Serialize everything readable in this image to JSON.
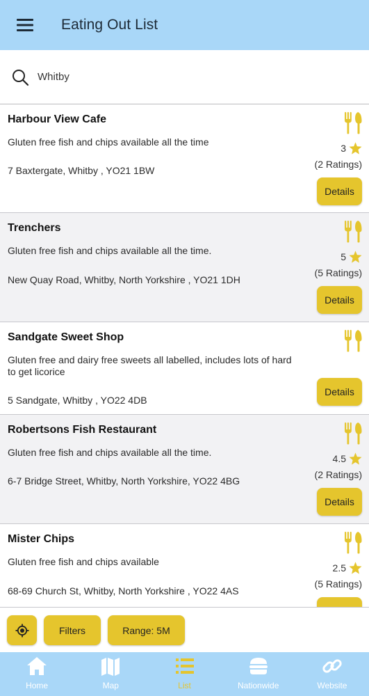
{
  "app": {
    "title": "Eating Out List"
  },
  "search": {
    "value": "Whitby"
  },
  "colors": {
    "header": "#a9d7f8",
    "accent": "#e5c52d",
    "tab_active": "#e5c52d"
  },
  "icons": {
    "menu": "hamburger-menu-icon",
    "search": "magnifier-icon",
    "cutlery": "fork-knife-icon",
    "star": "star-icon",
    "locate": "crosshair-icon"
  },
  "listings": [
    {
      "name": "Harbour View Cafe",
      "description": "Gluten free fish and chips available all the time",
      "address": "7 Baxtergate, Whitby , YO21 1BW",
      "rating": "3",
      "ratings_count": "(2 Ratings)",
      "details_label": "Details"
    },
    {
      "name": "Trenchers",
      "description": "Gluten free fish and chips available all the time.",
      "address": "New Quay Road, Whitby, North Yorkshire , YO21 1DH",
      "rating": "5",
      "ratings_count": "(5 Ratings)",
      "details_label": "Details"
    },
    {
      "name": "Sandgate Sweet Shop",
      "description": "Gluten free and dairy free sweets all labelled, includes lots of hard to get licorice",
      "address": "5 Sandgate, Whitby , YO22 4DB",
      "details_label": "Details"
    },
    {
      "name": "Robertsons Fish Restaurant",
      "description": "Gluten free fish and chips available all the time.",
      "address": "6-7 Bridge Street, Whitby, North Yorkshire, YO22 4BG",
      "rating": "4.5",
      "ratings_count": "(2 Ratings)",
      "details_label": "Details"
    },
    {
      "name": "Mister Chips",
      "description": "Gluten free fish and chips available",
      "address": "68-69 Church St, Whitby, North Yorkshire , YO22 4AS",
      "rating": "2.5",
      "ratings_count": "(5 Ratings)",
      "details_label": "Details"
    }
  ],
  "filters": {
    "filters_label": "Filters",
    "range_label": "Range: 5M"
  },
  "tabs": [
    {
      "label": "Home",
      "icon": "home-icon",
      "active": false
    },
    {
      "label": "Map",
      "icon": "map-icon",
      "active": false
    },
    {
      "label": "List",
      "icon": "list-icon",
      "active": true
    },
    {
      "label": "Nationwide",
      "icon": "burger-icon",
      "active": false
    },
    {
      "label": "Website",
      "icon": "link-icon",
      "active": false
    }
  ]
}
